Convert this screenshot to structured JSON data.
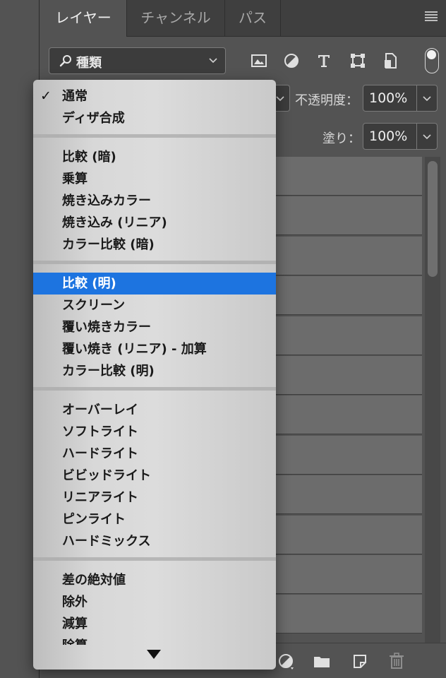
{
  "tabs": [
    {
      "label": "レイヤー",
      "active": true
    },
    {
      "label": "チャンネル",
      "active": false
    },
    {
      "label": "パス",
      "active": false
    }
  ],
  "filter": {
    "label": "種類",
    "icon": "search-icon"
  },
  "filter_icons": [
    "image-filter-icon",
    "adjustment-filter-icon",
    "type-filter-icon",
    "shape-filter-icon",
    "smart-object-filter-icon"
  ],
  "opacity": {
    "label": "不透明度：",
    "value": "100%"
  },
  "fill": {
    "label": "塗り：",
    "value": "100%"
  },
  "blend_menu": {
    "checked": "通常",
    "selected": "比較 (明)",
    "groups": [
      [
        "通常",
        "ディザ合成"
      ],
      [
        "比較 (暗)",
        "乗算",
        "焼き込みカラー",
        "焼き込み (リニア)",
        "カラー比較 (暗)"
      ],
      [
        "比較 (明)",
        "スクリーン",
        "覆い焼きカラー",
        "覆い焼き (リニア) - 加算",
        "カラー比較 (明)"
      ],
      [
        "オーバーレイ",
        "ソフトライト",
        "ハードライト",
        "ビビッドライト",
        "リニアライト",
        "ピンライト",
        "ハードミックス"
      ],
      [
        "差の絶対値",
        "除外",
        "減算",
        "除算"
      ]
    ]
  },
  "layer_rows": 12,
  "bottom_icons": [
    "adjustment-layer-icon",
    "new-group-icon",
    "new-layer-icon",
    "trash-icon"
  ],
  "colors": {
    "selection": "#1d74e0",
    "panel": "#535353",
    "tabbar": "#3f3f3f"
  }
}
